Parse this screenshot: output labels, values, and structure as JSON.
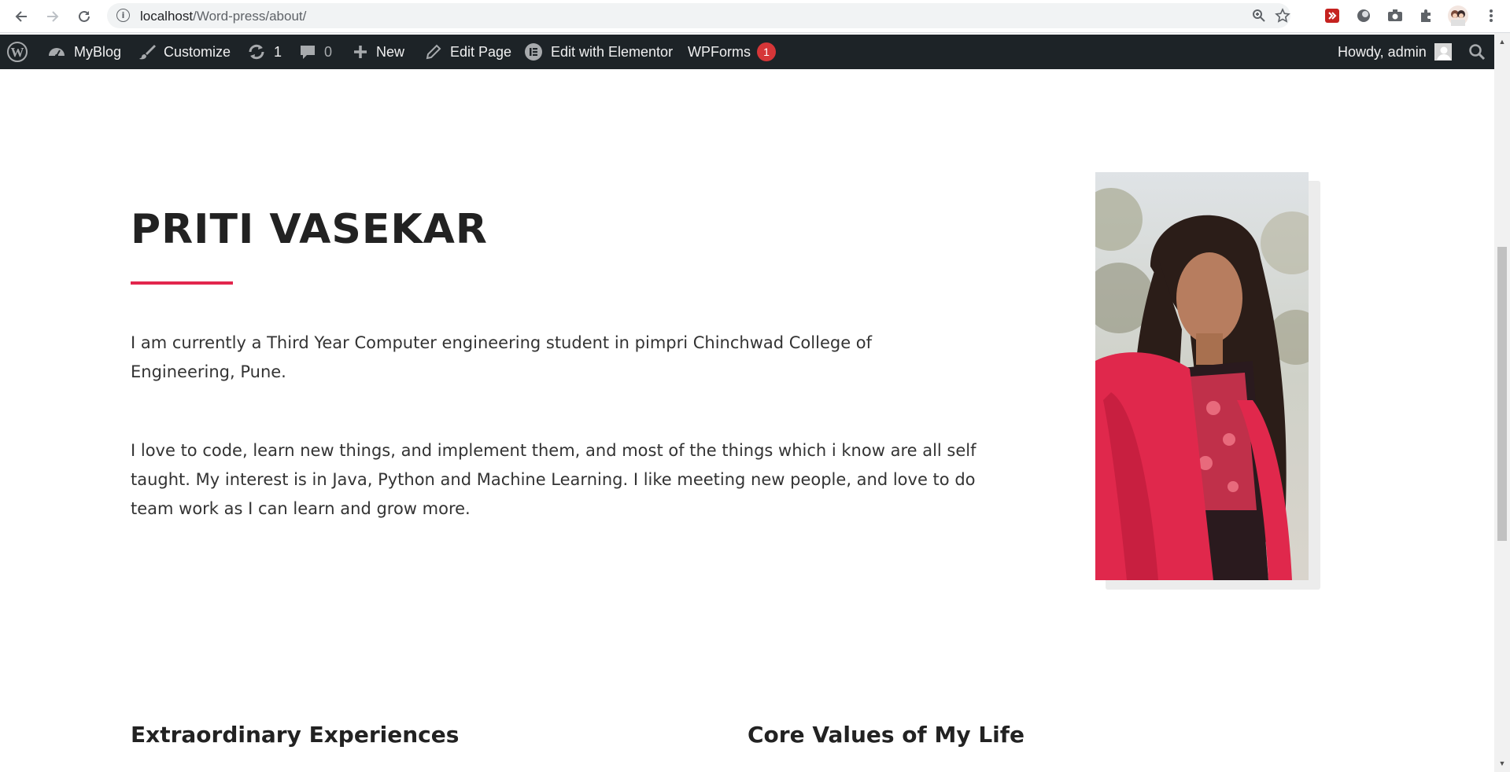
{
  "browser": {
    "url_host": "localhost",
    "url_path": "/Word-press/about/"
  },
  "adminbar": {
    "site_name": "MyBlog",
    "customize": "Customize",
    "updates_count": "1",
    "comments_count": "0",
    "new": "New",
    "edit_page": "Edit Page",
    "elementor": "Edit with Elementor",
    "wpforms": "WPForms",
    "wpforms_badge": "1",
    "howdy": "Howdy, admin"
  },
  "page": {
    "name": "PRITI VASEKAR",
    "paragraph1": "I am currently a Third Year Computer engineering student in pimpri Chinchwad College of Engineering, Pune.",
    "paragraph2": "I love to code, learn new things, and implement them, and most of the things which i know are all self taught. My interest is in Java, Python and Machine Learning. I like meeting new people, and love to do team work as I can learn and grow more.",
    "section1_title": "Extraordinary Experiences",
    "section2_title": "Core Values of My Life"
  },
  "colors": {
    "accent": "#e2264d",
    "adminbar_bg": "#1d2327",
    "badge": "#d63638"
  }
}
